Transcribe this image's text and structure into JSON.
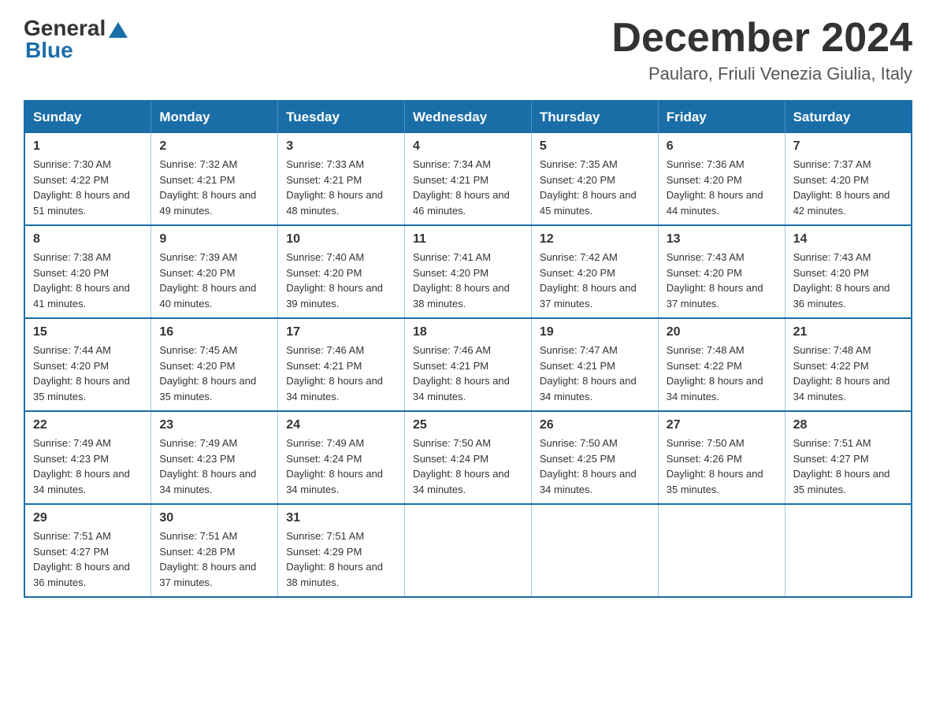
{
  "header": {
    "logo_general": "General",
    "logo_blue": "Blue",
    "month_title": "December 2024",
    "location": "Paularo, Friuli Venezia Giulia, Italy"
  },
  "days_of_week": [
    "Sunday",
    "Monday",
    "Tuesday",
    "Wednesday",
    "Thursday",
    "Friday",
    "Saturday"
  ],
  "weeks": [
    [
      {
        "day": "1",
        "sunrise": "7:30 AM",
        "sunset": "4:22 PM",
        "daylight": "8 hours and 51 minutes."
      },
      {
        "day": "2",
        "sunrise": "7:32 AM",
        "sunset": "4:21 PM",
        "daylight": "8 hours and 49 minutes."
      },
      {
        "day": "3",
        "sunrise": "7:33 AM",
        "sunset": "4:21 PM",
        "daylight": "8 hours and 48 minutes."
      },
      {
        "day": "4",
        "sunrise": "7:34 AM",
        "sunset": "4:21 PM",
        "daylight": "8 hours and 46 minutes."
      },
      {
        "day": "5",
        "sunrise": "7:35 AM",
        "sunset": "4:20 PM",
        "daylight": "8 hours and 45 minutes."
      },
      {
        "day": "6",
        "sunrise": "7:36 AM",
        "sunset": "4:20 PM",
        "daylight": "8 hours and 44 minutes."
      },
      {
        "day": "7",
        "sunrise": "7:37 AM",
        "sunset": "4:20 PM",
        "daylight": "8 hours and 42 minutes."
      }
    ],
    [
      {
        "day": "8",
        "sunrise": "7:38 AM",
        "sunset": "4:20 PM",
        "daylight": "8 hours and 41 minutes."
      },
      {
        "day": "9",
        "sunrise": "7:39 AM",
        "sunset": "4:20 PM",
        "daylight": "8 hours and 40 minutes."
      },
      {
        "day": "10",
        "sunrise": "7:40 AM",
        "sunset": "4:20 PM",
        "daylight": "8 hours and 39 minutes."
      },
      {
        "day": "11",
        "sunrise": "7:41 AM",
        "sunset": "4:20 PM",
        "daylight": "8 hours and 38 minutes."
      },
      {
        "day": "12",
        "sunrise": "7:42 AM",
        "sunset": "4:20 PM",
        "daylight": "8 hours and 37 minutes."
      },
      {
        "day": "13",
        "sunrise": "7:43 AM",
        "sunset": "4:20 PM",
        "daylight": "8 hours and 37 minutes."
      },
      {
        "day": "14",
        "sunrise": "7:43 AM",
        "sunset": "4:20 PM",
        "daylight": "8 hours and 36 minutes."
      }
    ],
    [
      {
        "day": "15",
        "sunrise": "7:44 AM",
        "sunset": "4:20 PM",
        "daylight": "8 hours and 35 minutes."
      },
      {
        "day": "16",
        "sunrise": "7:45 AM",
        "sunset": "4:20 PM",
        "daylight": "8 hours and 35 minutes."
      },
      {
        "day": "17",
        "sunrise": "7:46 AM",
        "sunset": "4:21 PM",
        "daylight": "8 hours and 34 minutes."
      },
      {
        "day": "18",
        "sunrise": "7:46 AM",
        "sunset": "4:21 PM",
        "daylight": "8 hours and 34 minutes."
      },
      {
        "day": "19",
        "sunrise": "7:47 AM",
        "sunset": "4:21 PM",
        "daylight": "8 hours and 34 minutes."
      },
      {
        "day": "20",
        "sunrise": "7:48 AM",
        "sunset": "4:22 PM",
        "daylight": "8 hours and 34 minutes."
      },
      {
        "day": "21",
        "sunrise": "7:48 AM",
        "sunset": "4:22 PM",
        "daylight": "8 hours and 34 minutes."
      }
    ],
    [
      {
        "day": "22",
        "sunrise": "7:49 AM",
        "sunset": "4:23 PM",
        "daylight": "8 hours and 34 minutes."
      },
      {
        "day": "23",
        "sunrise": "7:49 AM",
        "sunset": "4:23 PM",
        "daylight": "8 hours and 34 minutes."
      },
      {
        "day": "24",
        "sunrise": "7:49 AM",
        "sunset": "4:24 PM",
        "daylight": "8 hours and 34 minutes."
      },
      {
        "day": "25",
        "sunrise": "7:50 AM",
        "sunset": "4:24 PM",
        "daylight": "8 hours and 34 minutes."
      },
      {
        "day": "26",
        "sunrise": "7:50 AM",
        "sunset": "4:25 PM",
        "daylight": "8 hours and 34 minutes."
      },
      {
        "day": "27",
        "sunrise": "7:50 AM",
        "sunset": "4:26 PM",
        "daylight": "8 hours and 35 minutes."
      },
      {
        "day": "28",
        "sunrise": "7:51 AM",
        "sunset": "4:27 PM",
        "daylight": "8 hours and 35 minutes."
      }
    ],
    [
      {
        "day": "29",
        "sunrise": "7:51 AM",
        "sunset": "4:27 PM",
        "daylight": "8 hours and 36 minutes."
      },
      {
        "day": "30",
        "sunrise": "7:51 AM",
        "sunset": "4:28 PM",
        "daylight": "8 hours and 37 minutes."
      },
      {
        "day": "31",
        "sunrise": "7:51 AM",
        "sunset": "4:29 PM",
        "daylight": "8 hours and 38 minutes."
      },
      null,
      null,
      null,
      null
    ]
  ],
  "labels": {
    "sunrise_prefix": "Sunrise: ",
    "sunset_prefix": "Sunset: ",
    "daylight_prefix": "Daylight: "
  }
}
